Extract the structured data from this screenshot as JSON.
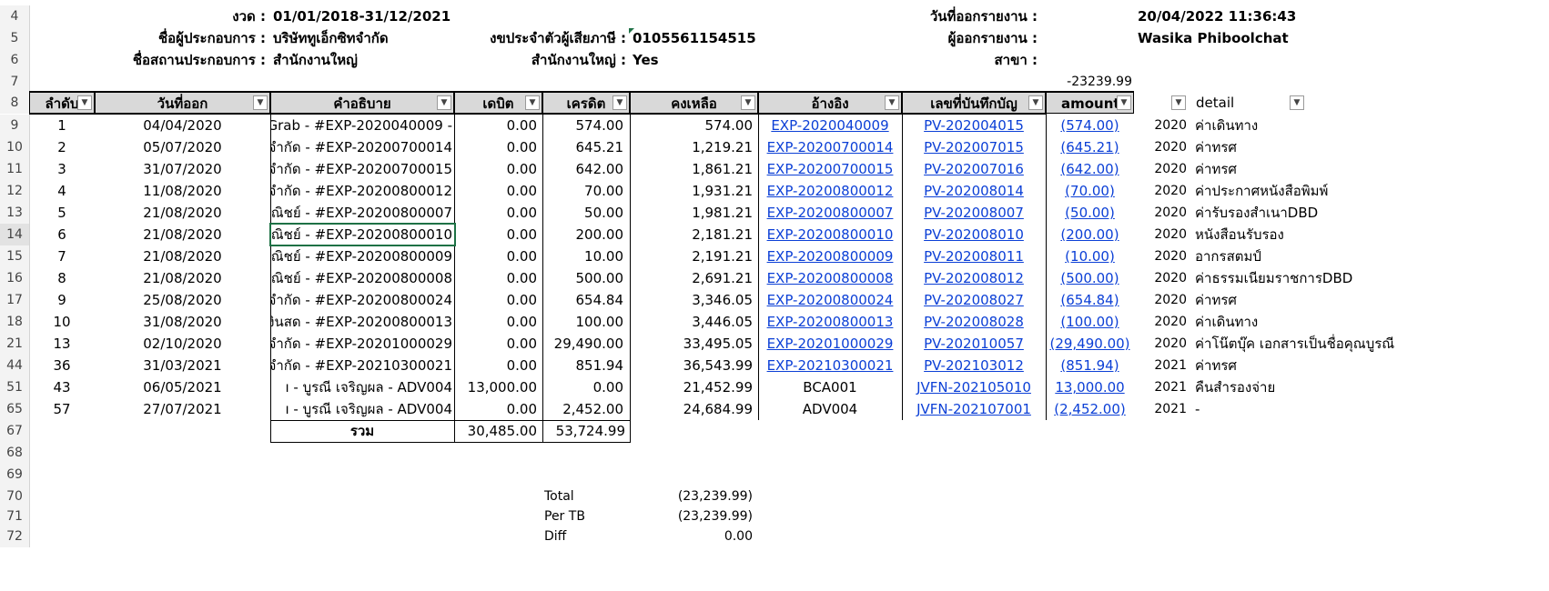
{
  "header": {
    "period_label": "งวด :",
    "period_value": "01/01/2018-31/12/2021",
    "report_date_label": "วันที่ออกรายงาน :",
    "report_date_value": "20/04/2022 11:36:43",
    "operator_label": "ชื่อผู้ประกอบการ :",
    "operator_value": "บริษัททูเอ็กซิทจำกัด",
    "taxid_label": "งขประจำตัวผู้เสียภาษี :",
    "taxid_value": "0105561154515",
    "issuer_label": "ผู้ออกรายงาน :",
    "issuer_value": "Wasika Phiboolchat",
    "place_label": "ชื่อสถานประกอบการ :",
    "place_value": "สำนักงานใหญ่",
    "hq_label": "สำนักงานใหญ่ :",
    "hq_value": "Yes",
    "branch_label": "สาขา :",
    "row7_value": "-23239.99"
  },
  "row_numbers": [
    "4",
    "5",
    "6",
    "7",
    "8",
    "9",
    "10",
    "11",
    "12",
    "13",
    "14",
    "15",
    "16",
    "17",
    "18",
    "21",
    "44",
    "51",
    "65",
    "67",
    "68",
    "69",
    "70",
    "71",
    "72"
  ],
  "columns": [
    "ลำดับ",
    "วันที่ออก",
    "คำอธิบาย",
    "เดบิต",
    "เครดิต",
    "คงเหลือ",
    "อ้างอิง",
    "เลขที่บันทึกบัญ",
    "amount",
    "",
    "detail"
  ],
  "rows": [
    {
      "no": "1",
      "date": "04/04/2020",
      "desc": "- Grab - #EXP-2020040009",
      "debit": "0.00",
      "credit": "574.00",
      "balance": "574.00",
      "ref": "EXP-2020040009",
      "voucher": "PV-202004015",
      "amount": "(574.00)",
      "year": "2020",
      "detail": "ค่าเดินทาง"
    },
    {
      "no": "2",
      "date": "05/07/2020",
      "desc": "จำกัด - #EXP-20200700014",
      "debit": "0.00",
      "credit": "645.21",
      "balance": "1,219.21",
      "ref": "EXP-20200700014",
      "voucher": "PV-202007015",
      "amount": "(645.21)",
      "year": "2020",
      "detail": "ค่าทรศ"
    },
    {
      "no": "3",
      "date": "31/07/2020",
      "desc": "จำกัด - #EXP-20200700015",
      "debit": "0.00",
      "credit": "642.00",
      "balance": "1,861.21",
      "ref": "EXP-20200700015",
      "voucher": "PV-202007016",
      "amount": "(642.00)",
      "year": "2020",
      "detail": "ค่าทรศ"
    },
    {
      "no": "4",
      "date": "11/08/2020",
      "desc": "จำกัด - #EXP-20200800012",
      "debit": "0.00",
      "credit": "70.00",
      "balance": "1,931.21",
      "ref": "EXP-20200800012",
      "voucher": "PV-202008014",
      "amount": "(70.00)",
      "year": "2020",
      "detail": "ค่าประกาศหนังสือพิมพ์"
    },
    {
      "no": "5",
      "date": "21/08/2020",
      "desc": "ณิชย์ - #EXP-20200800007",
      "debit": "0.00",
      "credit": "50.00",
      "balance": "1,981.21",
      "ref": "EXP-20200800007",
      "voucher": "PV-202008007",
      "amount": "(50.00)",
      "year": "2020",
      "detail": "ค่ารับรองสำเนาDBD"
    },
    {
      "no": "6",
      "date": "21/08/2020",
      "desc": "ณิชย์ - #EXP-20200800010",
      "debit": "0.00",
      "credit": "200.00",
      "balance": "2,181.21",
      "ref": "EXP-20200800010",
      "voucher": "PV-202008010",
      "amount": "(200.00)",
      "year": "2020",
      "detail": "หนังสือนรับรอง"
    },
    {
      "no": "7",
      "date": "21/08/2020",
      "desc": "ณิชย์ - #EXP-20200800009",
      "debit": "0.00",
      "credit": "10.00",
      "balance": "2,191.21",
      "ref": "EXP-20200800009",
      "voucher": "PV-202008011",
      "amount": "(10.00)",
      "year": "2020",
      "detail": "อากรสตมป์"
    },
    {
      "no": "8",
      "date": "21/08/2020",
      "desc": "ณิชย์ - #EXP-20200800008",
      "debit": "0.00",
      "credit": "500.00",
      "balance": "2,691.21",
      "ref": "EXP-20200800008",
      "voucher": "PV-202008012",
      "amount": "(500.00)",
      "year": "2020",
      "detail": "ค่าธรรมเนียมราชการDBD"
    },
    {
      "no": "9",
      "date": "25/08/2020",
      "desc": "จำกัด - #EXP-20200800024",
      "debit": "0.00",
      "credit": "654.84",
      "balance": "3,346.05",
      "ref": "EXP-20200800024",
      "voucher": "PV-202008027",
      "amount": "(654.84)",
      "year": "2020",
      "detail": "ค่าทรศ"
    },
    {
      "no": "10",
      "date": "31/08/2020",
      "desc": "งินสด - #EXP-20200800013",
      "debit": "0.00",
      "credit": "100.00",
      "balance": "3,446.05",
      "ref": "EXP-20200800013",
      "voucher": "PV-202008028",
      "amount": "(100.00)",
      "year": "2020",
      "detail": "ค่าเดินทาง"
    },
    {
      "no": "13",
      "date": "02/10/2020",
      "desc": "จำกัด - #EXP-20201000029",
      "debit": "0.00",
      "credit": "29,490.00",
      "balance": "33,495.05",
      "ref": "EXP-20201000029",
      "voucher": "PV-202010057",
      "amount": "(29,490.00)",
      "year": "2020",
      "detail": "ค่าโน๊ตบุ๊ค เอกสารเป็นชื่อคุณบูรณี"
    },
    {
      "no": "36",
      "date": "31/03/2021",
      "desc": "จำกัด - #EXP-20210300021",
      "debit": "0.00",
      "credit": "851.94",
      "balance": "36,543.99",
      "ref": "EXP-20210300021",
      "voucher": "PV-202103012",
      "amount": "(851.94)",
      "year": "2021",
      "detail": "ค่าทรศ"
    },
    {
      "no": "43",
      "date": "06/05/2021",
      "desc": "ı - บูรณี เจริญผล - ADV004",
      "debit": "13,000.00",
      "credit": "0.00",
      "balance": "21,452.99",
      "ref": "BCA001",
      "voucher": "JVFN-202105010",
      "amount": "13,000.00",
      "year": "2021",
      "detail": "คืนสำรองจ่าย"
    },
    {
      "no": "57",
      "date": "27/07/2021",
      "desc": "ı - บูรณี เจริญผล - ADV004",
      "debit": "0.00",
      "credit": "2,452.00",
      "balance": "24,684.99",
      "ref": "ADV004",
      "voucher": "JVFN-202107001",
      "amount": "(2,452.00)",
      "year": "2021",
      "detail": "-"
    }
  ],
  "totals": {
    "label": "รวม",
    "debit": "30,485.00",
    "credit": "53,724.99"
  },
  "summary": [
    {
      "label": "Total",
      "value": "(23,239.99)"
    },
    {
      "label": "Per TB",
      "value": "(23,239.99)"
    },
    {
      "label": "Diff",
      "value": "0.00"
    }
  ],
  "colors": {
    "link": "#0b3fd6",
    "header_bg": "#d9d9d9",
    "selection": "#1e7145"
  }
}
